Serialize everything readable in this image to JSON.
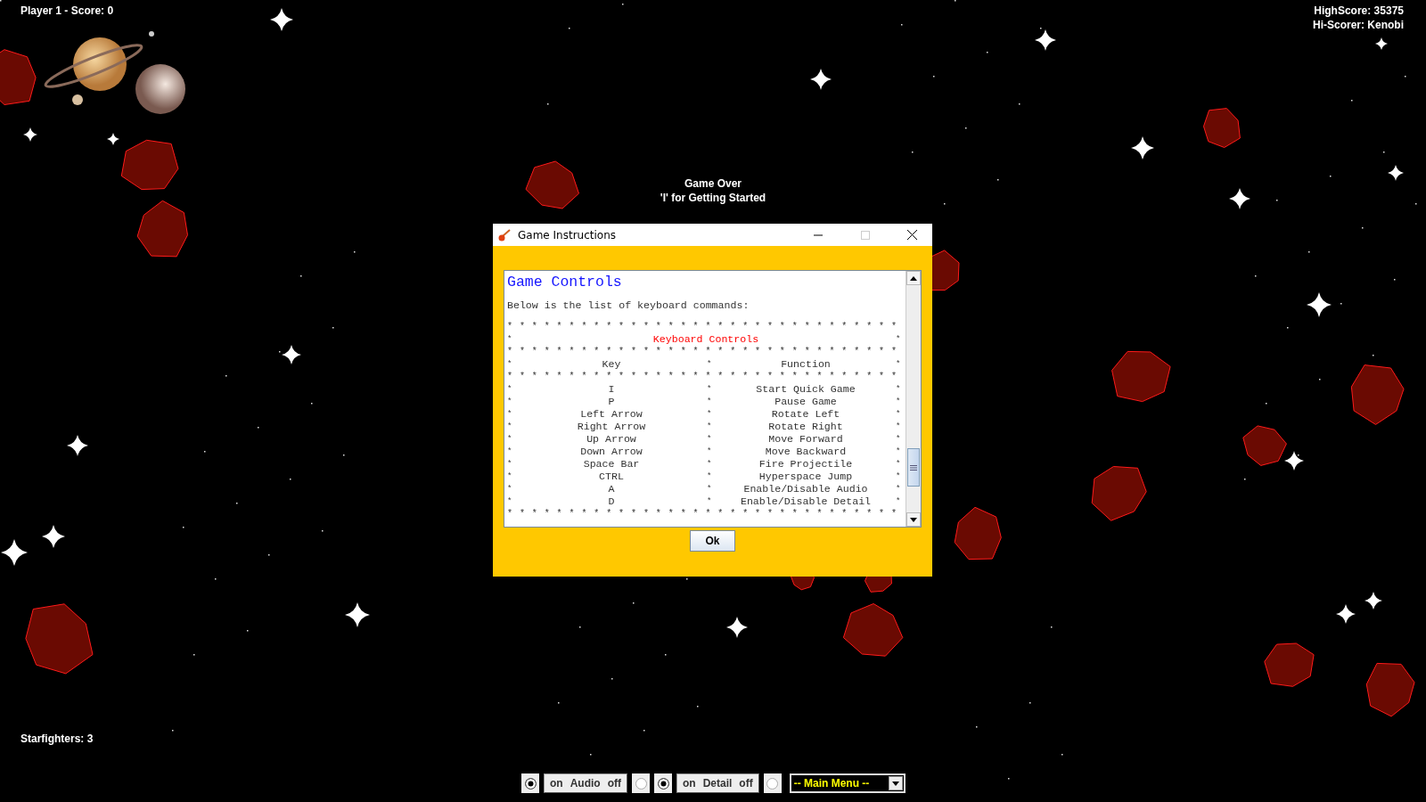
{
  "hud": {
    "player_score": "Player 1 - Score: 0",
    "high_score": "HighScore: 35375",
    "hi_scorer": "Hi-Scorer: Kenobi",
    "starfighters": "Starfighters: 3",
    "status_lines": [
      "Game Over",
      "'I' for Getting Started"
    ]
  },
  "dialog": {
    "title": "Game Instructions",
    "heading": "Game Controls",
    "intro": "Below is the list of keyboard commands:",
    "lines": [
      {
        "kind": "border",
        "text": "* * * * * * * * * * * * * * * * * * * * * * * * * * * * * * * *"
      },
      {
        "kind": "title",
        "left": "*",
        "text": "Keyboard Controls",
        "right": "*"
      },
      {
        "kind": "border",
        "text": "* * * * * * * * * * * * * * * * * * * * * * * * * * * * * * * *"
      },
      {
        "kind": "row",
        "left": "*",
        "key": "Key",
        "mid": "*",
        "function": "Function",
        "right": "*"
      },
      {
        "kind": "border",
        "text": "* * * * * * * * * * * * * * * * * * * * * * * * * * * * * * * *"
      },
      {
        "kind": "row",
        "left": "*",
        "key": "I",
        "mid": "*",
        "function": "Start Quick Game",
        "right": "*"
      },
      {
        "kind": "row",
        "left": "*",
        "key": "P",
        "mid": "*",
        "function": "Pause Game",
        "right": "*"
      },
      {
        "kind": "row",
        "left": "*",
        "key": "Left Arrow",
        "mid": "*",
        "function": "Rotate Left",
        "right": "*"
      },
      {
        "kind": "row",
        "left": "*",
        "key": "Right Arrow",
        "mid": "*",
        "function": "Rotate Right",
        "right": "*"
      },
      {
        "kind": "row",
        "left": "*",
        "key": "Up Arrow",
        "mid": "*",
        "function": "Move Forward",
        "right": "*"
      },
      {
        "kind": "row",
        "left": "*",
        "key": "Down Arrow",
        "mid": "*",
        "function": "Move Backward",
        "right": "*"
      },
      {
        "kind": "row",
        "left": "*",
        "key": "Space Bar",
        "mid": "*",
        "function": "Fire Projectile",
        "right": "*"
      },
      {
        "kind": "row",
        "left": "*",
        "key": "CTRL",
        "mid": "*",
        "function": "Hyperspace Jump",
        "right": "*"
      },
      {
        "kind": "row",
        "left": "*",
        "key": "A",
        "mid": "*",
        "function": "Enable/Disable Audio",
        "right": "*"
      },
      {
        "kind": "row",
        "left": "*",
        "key": "D",
        "mid": "*",
        "function": "Enable/Disable Detail",
        "right": "*"
      },
      {
        "kind": "border",
        "text": "* * * * * * * * * * * * * * * * * * * * * * * * * * * * * * * *"
      }
    ],
    "ok_button": "Ok"
  },
  "toggles": [
    {
      "on_text": "on",
      "label": "Audio",
      "off_text": "off",
      "radios": [
        {
          "selected": true
        },
        {
          "selected": false
        }
      ]
    },
    {
      "on_text": "on",
      "label": "Detail",
      "off_text": "off",
      "radios": [
        {
          "selected": true
        },
        {
          "selected": false
        }
      ]
    }
  ],
  "menu": {
    "value": "-- Main Menu --"
  }
}
